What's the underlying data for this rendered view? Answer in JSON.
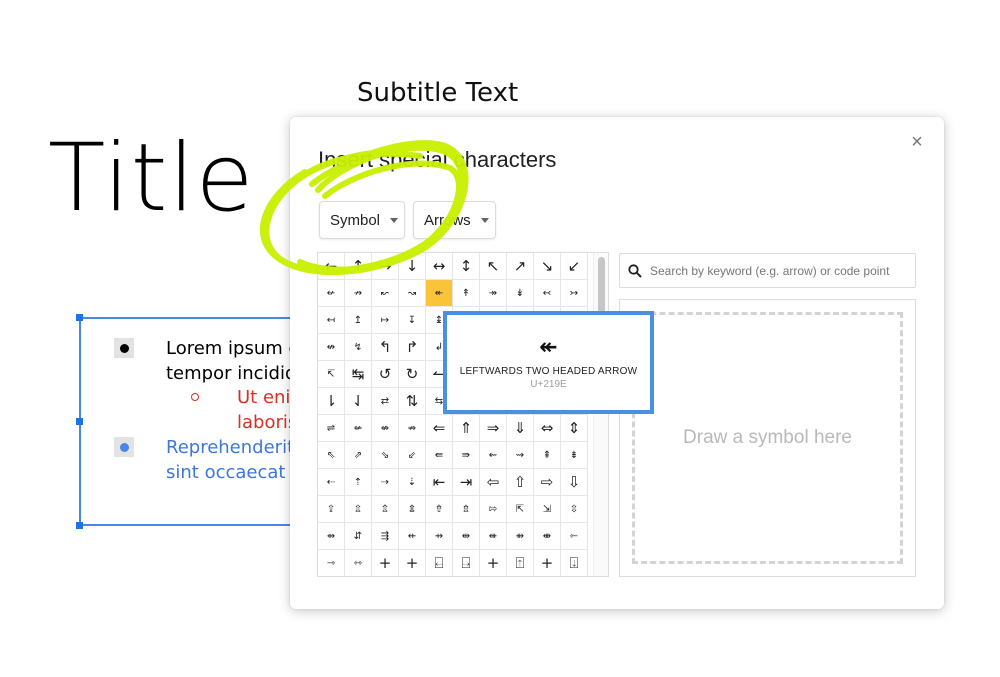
{
  "slide": {
    "title": "Title F",
    "subtitle": "Subtitle Text",
    "textbox": {
      "line1": "Lorem ipsum d",
      "line2": "tempor incidid",
      "line3": "Ut eni",
      "line4": "laboris",
      "line5": "Reprehenderit",
      "line6": "sint occaecat c"
    }
  },
  "dialog": {
    "title": "Insert special characters",
    "close": "×",
    "dropdown_category": "Symbol",
    "dropdown_subcategory": "Arrows",
    "search_placeholder": "Search by keyword (e.g. arrow) or code point",
    "draw_placeholder": "Draw a symbol here"
  },
  "symbols": [
    "←",
    "↑",
    "→",
    "↓",
    "↔",
    "↕",
    "↖",
    "↗",
    "↘",
    "↙",
    "↚",
    "↛",
    "↜",
    "↝",
    "↞",
    "↟",
    "↠",
    "↡",
    "↢",
    "↣",
    "↤",
    "↥",
    "↦",
    "↧",
    "↨",
    "↩",
    "↪",
    "↫",
    "↬",
    "↭",
    "↮",
    "↯",
    "↰",
    "↱",
    "↲",
    "↳",
    "↴",
    "↵",
    "↶",
    "↷",
    "↸",
    "↹",
    "↺",
    "↻",
    "↼",
    "↽",
    "↾",
    "↿",
    "⇀",
    "⇁",
    "⇂",
    "⇃",
    "⇄",
    "⇅",
    "⇆",
    "⇇",
    "⇈",
    "⇉",
    "⇊",
    "⇋",
    "⇌",
    "⇍",
    "⇎",
    "⇏",
    "⇐",
    "⇑",
    "⇒",
    "⇓",
    "⇔",
    "⇕",
    "⇖",
    "⇗",
    "⇘",
    "⇙",
    "⇚",
    "⇛",
    "⇜",
    "⇝",
    "⇞",
    "⇟",
    "⇠",
    "⇡",
    "⇢",
    "⇣",
    "⇤",
    "⇥",
    "⇦",
    "⇧",
    "⇨",
    "⇩",
    "⇪",
    "⇫",
    "⇬",
    "⇭",
    "⇮",
    "⇯",
    "⇰",
    "⇱",
    "⇲",
    "⇳",
    "⇴",
    "⇵",
    "⇶",
    "⇷",
    "⇸",
    "⇹",
    "⇺",
    "⇻",
    "⇼",
    "⇽",
    "⇾",
    "⇿",
    "+",
    "+",
    "⍇",
    "⍈",
    "+",
    "⍐",
    "+",
    "⍗"
  ],
  "selected_index": 14,
  "tooltip": {
    "glyph": "↞",
    "name": "LEFTWARDS TWO HEADED ARROW",
    "code": "U+219E"
  },
  "colors": {
    "selection_blue": "#4a86e8",
    "selected_cell": "#f9c43a",
    "highlighter": "#c8f000",
    "bullet_black": "#000000",
    "bullet_red": "#d93025",
    "bullet_blue": "#4a86e8"
  },
  "icons": {
    "search": "magnifier-icon",
    "close": "close-icon",
    "caret": "caret-down-icon"
  }
}
